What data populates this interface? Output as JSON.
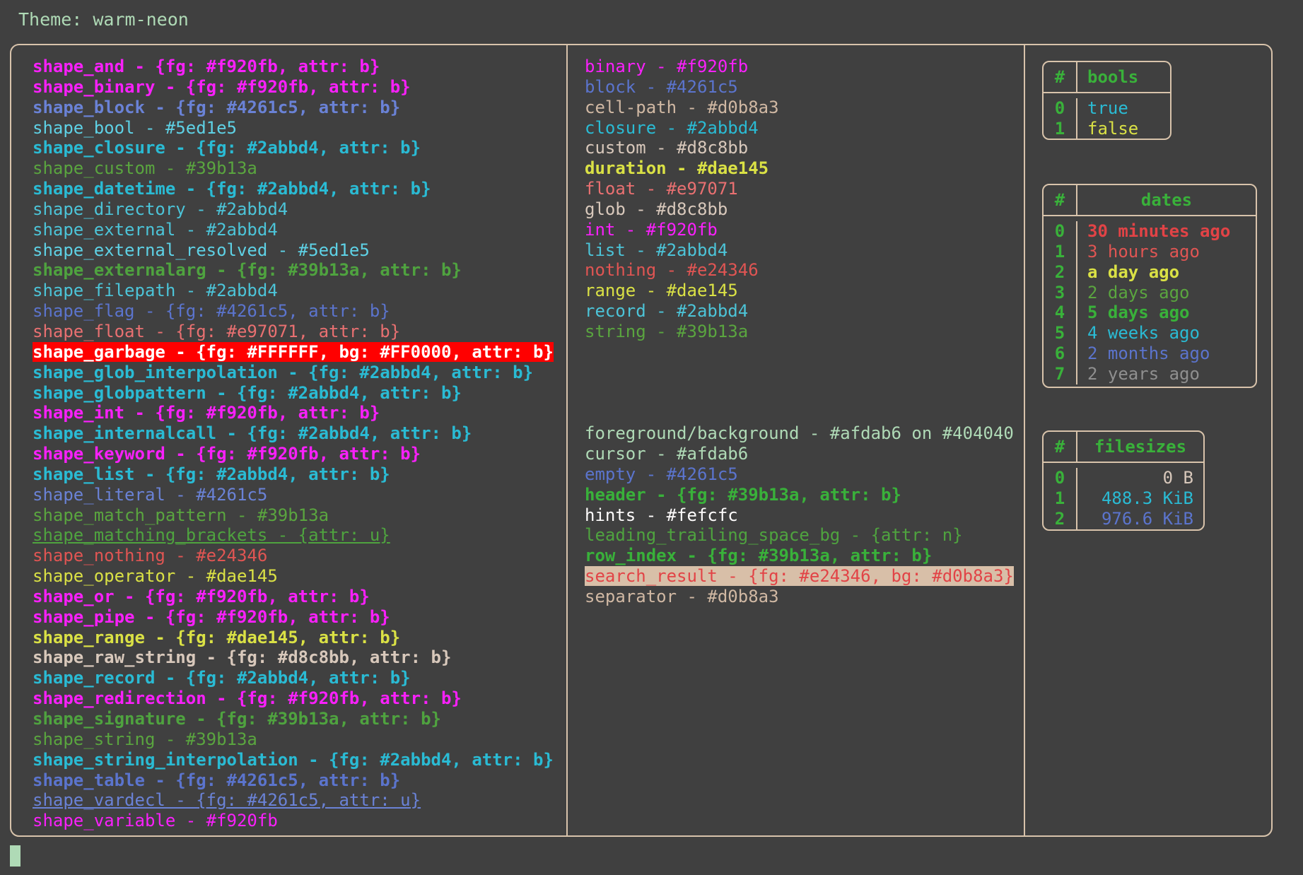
{
  "header": {
    "label": "Theme: warm-neon"
  },
  "colors": {
    "background": "#404040",
    "foreground": "#afdab6",
    "border": "#d8c3ab",
    "cursor": "#afdab6",
    "magenta": "#f920fb",
    "blue": "#4261c5",
    "cyan_light": "#5ed1e5",
    "cyan": "#2abbd4",
    "green": "#39b13a",
    "green_light": "#69c96a",
    "red": "#e24346",
    "salmon": "#e97071",
    "yellow": "#dae145",
    "tan": "#d8c8bb",
    "tan_dark": "#d0b8a3",
    "white": "#fefcfc",
    "grey": "#8f8f8f"
  },
  "shapes_column": [
    {
      "text": "shape_and - {fg: #f920fb, attr: b}",
      "color": "#f920fb",
      "bold": true,
      "underline": false
    },
    {
      "text": "shape_binary - {fg: #f920fb, attr: b}",
      "color": "#f920fb",
      "bold": true,
      "underline": false
    },
    {
      "text": "shape_block - {fg: #4261c5, attr: b}",
      "color": "#6a82d6",
      "bold": true,
      "underline": false
    },
    {
      "text": "shape_bool - #5ed1e5",
      "color": "#5ed1e5",
      "bold": false,
      "underline": false
    },
    {
      "text": "shape_closure - {fg: #2abbd4, attr: b}",
      "color": "#2abbd4",
      "bold": true,
      "underline": false
    },
    {
      "text": "shape_custom - #39b13a",
      "color": "#5aa53f",
      "bold": false,
      "underline": false
    },
    {
      "text": "shape_datetime - {fg: #2abbd4, attr: b}",
      "color": "#2abbd4",
      "bold": true,
      "underline": false
    },
    {
      "text": "shape_directory - #2abbd4",
      "color": "#4cc4d8",
      "bold": false,
      "underline": false
    },
    {
      "text": "shape_external - #2abbd4",
      "color": "#4cc4d8",
      "bold": false,
      "underline": false
    },
    {
      "text": "shape_external_resolved - #5ed1e5",
      "color": "#5ed1e5",
      "bold": false,
      "underline": false
    },
    {
      "text": "shape_externalarg - {fg: #39b13a, attr: b}",
      "color": "#4fa33f",
      "bold": true,
      "underline": false
    },
    {
      "text": "shape_filepath - #2abbd4",
      "color": "#4cc4d8",
      "bold": false,
      "underline": false
    },
    {
      "text": "shape_flag - {fg: #4261c5, attr: b}",
      "color": "#5b74cd",
      "bold": false,
      "underline": false
    },
    {
      "text": "shape_float - {fg: #e97071, attr: b}",
      "color": "#e97071",
      "bold": false,
      "underline": false
    },
    {
      "text": "shape_garbage - {fg: #FFFFFF, bg: #FF0000, attr: b}",
      "color": "#ffffff",
      "bg": "#ff0000",
      "bold": true,
      "underline": false
    },
    {
      "text": "shape_glob_interpolation - {fg: #2abbd4, attr: b}",
      "color": "#2abbd4",
      "bold": true,
      "underline": false
    },
    {
      "text": "shape_globpattern - {fg: #2abbd4, attr: b}",
      "color": "#2abbd4",
      "bold": true,
      "underline": false
    },
    {
      "text": "shape_int - {fg: #f920fb, attr: b}",
      "color": "#f920fb",
      "bold": true,
      "underline": false
    },
    {
      "text": "shape_internalcall - {fg: #2abbd4, attr: b}",
      "color": "#2abbd4",
      "bold": true,
      "underline": false
    },
    {
      "text": "shape_keyword - {fg: #f920fb, attr: b}",
      "color": "#f920fb",
      "bold": true,
      "underline": false
    },
    {
      "text": "shape_list - {fg: #2abbd4, attr: b}",
      "color": "#2abbd4",
      "bold": true,
      "underline": false
    },
    {
      "text": "shape_literal - #4261c5",
      "color": "#6a82d6",
      "bold": false,
      "underline": false
    },
    {
      "text": "shape_match_pattern - #39b13a",
      "color": "#5aa53f",
      "bold": false,
      "underline": false
    },
    {
      "text": "shape_matching_brackets - {attr: u}",
      "color": "#4fa33f",
      "bold": false,
      "underline": true
    },
    {
      "text": "shape_nothing - #e24346",
      "color": "#e05553",
      "bold": false,
      "underline": false
    },
    {
      "text": "shape_operator - #dae145",
      "color": "#dae145",
      "bold": false,
      "underline": false
    },
    {
      "text": "shape_or - {fg: #f920fb, attr: b}",
      "color": "#f920fb",
      "bold": true,
      "underline": false
    },
    {
      "text": "shape_pipe - {fg: #f920fb, attr: b}",
      "color": "#f920fb",
      "bold": true,
      "underline": false
    },
    {
      "text": "shape_range - {fg: #dae145, attr: b}",
      "color": "#dae145",
      "bold": true,
      "underline": false
    },
    {
      "text": "shape_raw_string - {fg: #d8c8bb, attr: b}",
      "color": "#d8c8bb",
      "bold": true,
      "underline": false
    },
    {
      "text": "shape_record - {fg: #2abbd4, attr: b}",
      "color": "#2abbd4",
      "bold": true,
      "underline": false
    },
    {
      "text": "shape_redirection - {fg: #f920fb, attr: b}",
      "color": "#f920fb",
      "bold": true,
      "underline": false
    },
    {
      "text": "shape_signature - {fg: #39b13a, attr: b}",
      "color": "#4fa33f",
      "bold": true,
      "underline": false
    },
    {
      "text": "shape_string - #39b13a",
      "color": "#5aa53f",
      "bold": false,
      "underline": false
    },
    {
      "text": "shape_string_interpolation - {fg: #2abbd4, attr: b}",
      "color": "#2abbd4",
      "bold": true,
      "underline": false
    },
    {
      "text": "shape_table - {fg: #4261c5, attr: b}",
      "color": "#5b74cd",
      "bold": true,
      "underline": false
    },
    {
      "text": "shape_vardecl - {fg: #4261c5, attr: u}",
      "color": "#6a82d6",
      "bold": false,
      "underline": true
    },
    {
      "text": "shape_variable - #f920fb",
      "color": "#f920fb",
      "bold": false,
      "underline": false
    }
  ],
  "types_column": [
    {
      "text": "binary - #f920fb",
      "color": "#f920fb",
      "bold": false,
      "underline": false
    },
    {
      "text": "block - #4261c5",
      "color": "#5b74cd",
      "bold": false,
      "underline": false
    },
    {
      "text": "cell-path - #d0b8a3",
      "color": "#d0b8a3",
      "bold": false,
      "underline": false
    },
    {
      "text": "closure - #2abbd4",
      "color": "#2abbd4",
      "bold": false,
      "underline": false
    },
    {
      "text": "custom - #d8c8bb",
      "color": "#d8c8bb",
      "bold": false,
      "underline": false
    },
    {
      "text": "duration - #dae145",
      "color": "#dae145",
      "bold": true,
      "underline": false
    },
    {
      "text": "float - #e97071",
      "color": "#e97071",
      "bold": false,
      "underline": false
    },
    {
      "text": "glob - #d8c8bb",
      "color": "#d8c8bb",
      "bold": false,
      "underline": false
    },
    {
      "text": "int - #f920fb",
      "color": "#f920fb",
      "bold": false,
      "underline": false
    },
    {
      "text": "list - #2abbd4",
      "color": "#4cc4d8",
      "bold": false,
      "underline": false
    },
    {
      "text": "nothing - #e24346",
      "color": "#e05553",
      "bold": false,
      "underline": false
    },
    {
      "text": "range - #dae145",
      "color": "#dae145",
      "bold": false,
      "underline": false
    },
    {
      "text": "record - #2abbd4",
      "color": "#4cc4d8",
      "bold": false,
      "underline": false
    },
    {
      "text": "string - #39b13a",
      "color": "#5aa53f",
      "bold": false,
      "underline": false
    }
  ],
  "ui_column": [
    {
      "text": "foreground/background - #afdab6 on #404040",
      "color": "#afdab6",
      "bold": false,
      "underline": false
    },
    {
      "text": "cursor - #afdab6",
      "color": "#afdab6",
      "bold": false,
      "underline": false
    },
    {
      "text": "empty - #4261c5",
      "color": "#5b74cd",
      "bold": false,
      "underline": false
    },
    {
      "text": "header - {fg: #39b13a, attr: b}",
      "color": "#39b13a",
      "bold": true,
      "underline": false
    },
    {
      "text": "hints - #fefcfc",
      "color": "#fefcfc",
      "bold": false,
      "underline": false
    },
    {
      "text": "leading_trailing_space_bg - {attr: n}",
      "color": "#4fa33f",
      "bold": false,
      "underline": false
    },
    {
      "text": "row_index - {fg: #39b13a, attr: b}",
      "color": "#39b13a",
      "bold": true,
      "underline": false
    },
    {
      "text": "search_result - {fg: #e24346, bg: #d0b8a3}",
      "color": "#e24346",
      "bg": "#d8bfa8",
      "bold": false,
      "underline": false
    },
    {
      "text": "separator - #d0b8a3",
      "color": "#d0b8a3",
      "bold": false,
      "underline": false
    }
  ],
  "tables": [
    {
      "name": "bools",
      "index_header": "#",
      "value_header": "bools",
      "rows": [
        {
          "index": "0",
          "value": "true",
          "color": "#2abbd4",
          "bold": false
        },
        {
          "index": "1",
          "value": "false",
          "color": "#dae145",
          "bold": false
        }
      ]
    },
    {
      "name": "dates",
      "index_header": "#",
      "value_header": "dates",
      "rows": [
        {
          "index": "0",
          "value": "30 minutes ago",
          "color": "#e24346",
          "bold": true
        },
        {
          "index": "1",
          "value": "3 hours ago",
          "color": "#e05553",
          "bold": false
        },
        {
          "index": "2",
          "value": "a day ago",
          "color": "#dae145",
          "bold": true
        },
        {
          "index": "3",
          "value": "2 days ago",
          "color": "#5aa53f",
          "bold": false
        },
        {
          "index": "4",
          "value": "5 days ago",
          "color": "#39b13a",
          "bold": true
        },
        {
          "index": "5",
          "value": "4 weeks ago",
          "color": "#2abbd4",
          "bold": false
        },
        {
          "index": "6",
          "value": "2 months ago",
          "color": "#5b74cd",
          "bold": false
        },
        {
          "index": "7",
          "value": "2 years ago",
          "color": "#8f8f8f",
          "bold": false
        }
      ]
    },
    {
      "name": "filesizes",
      "index_header": "#",
      "value_header": "filesizes",
      "rows": [
        {
          "index": "0",
          "value": "0 B",
          "color": "#d8c8bb",
          "bold": false
        },
        {
          "index": "1",
          "value": "488.3 KiB",
          "color": "#2abbd4",
          "bold": false
        },
        {
          "index": "2",
          "value": "976.6 KiB",
          "color": "#5b74cd",
          "bold": false
        }
      ]
    }
  ]
}
